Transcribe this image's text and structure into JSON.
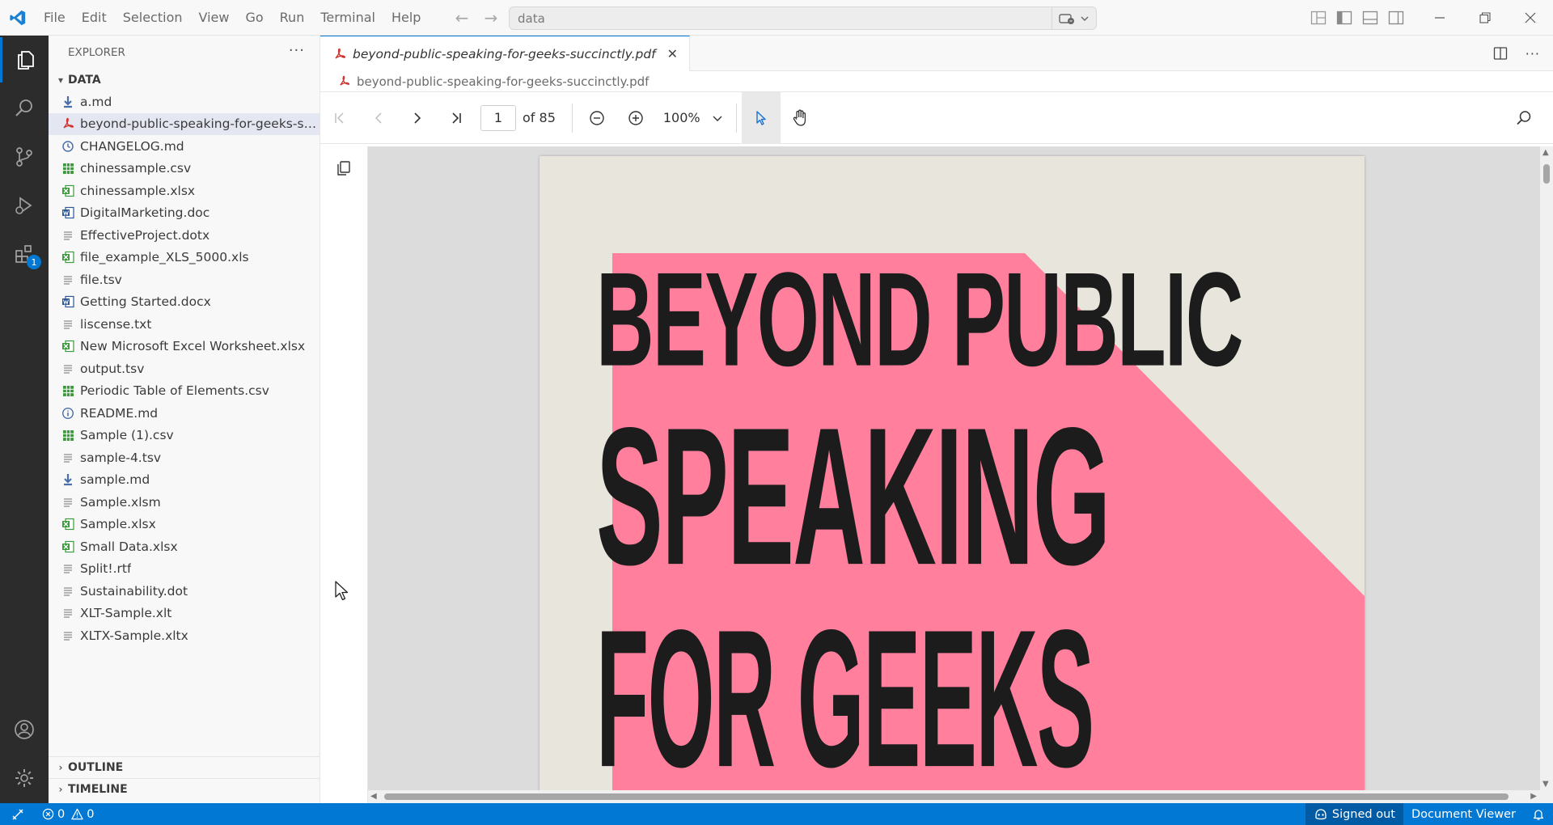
{
  "titlebar": {
    "menus": [
      "File",
      "Edit",
      "Selection",
      "View",
      "Go",
      "Run",
      "Terminal",
      "Help"
    ],
    "search_text": "data"
  },
  "activity": {
    "extensions_badge": "1"
  },
  "sidebar": {
    "title": "EXPLORER",
    "folder": "DATA",
    "files": [
      {
        "name": "a.md",
        "icon": "markdown-icon",
        "color": "#4b6fa8"
      },
      {
        "name": "beyond-public-speaking-for-geeks-succinctly.pdf",
        "icon": "pdf-icon",
        "color": "#d0312d",
        "selected": true
      },
      {
        "name": "CHANGELOG.md",
        "icon": "changelog-icon",
        "color": "#4b6fa8"
      },
      {
        "name": "chinessample.csv",
        "icon": "csv-icon",
        "color": "#3b9a3b"
      },
      {
        "name": "chinessample.xlsx",
        "icon": "excel-icon",
        "color": "#3b9a3b"
      },
      {
        "name": "DigitalMarketing.doc",
        "icon": "word-icon",
        "color": "#2b5797"
      },
      {
        "name": "EffectiveProject.dotx",
        "icon": "text-file-icon",
        "color": "#8a8a8a"
      },
      {
        "name": "file_example_XLS_5000.xls",
        "icon": "excel-icon",
        "color": "#3b9a3b"
      },
      {
        "name": "file.tsv",
        "icon": "text-file-icon",
        "color": "#8a8a8a"
      },
      {
        "name": "Getting Started.docx",
        "icon": "word-icon",
        "color": "#2b5797"
      },
      {
        "name": "liscense.txt",
        "icon": "text-file-icon",
        "color": "#8a8a8a"
      },
      {
        "name": "New Microsoft Excel Worksheet.xlsx",
        "icon": "excel-icon",
        "color": "#3b9a3b"
      },
      {
        "name": "output.tsv",
        "icon": "text-file-icon",
        "color": "#8a8a8a"
      },
      {
        "name": "Periodic Table of Elements.csv",
        "icon": "csv-icon",
        "color": "#3b9a3b"
      },
      {
        "name": "README.md",
        "icon": "info-icon",
        "color": "#4b6fa8"
      },
      {
        "name": "Sample (1).csv",
        "icon": "csv-icon",
        "color": "#3b9a3b"
      },
      {
        "name": "sample-4.tsv",
        "icon": "text-file-icon",
        "color": "#8a8a8a"
      },
      {
        "name": "sample.md",
        "icon": "markdown-icon",
        "color": "#4b6fa8"
      },
      {
        "name": "Sample.xlsm",
        "icon": "text-file-icon",
        "color": "#8a8a8a"
      },
      {
        "name": "Sample.xlsx",
        "icon": "excel-icon",
        "color": "#3b9a3b"
      },
      {
        "name": "Small Data.xlsx",
        "icon": "excel-icon",
        "color": "#3b9a3b"
      },
      {
        "name": "Split!.rtf",
        "icon": "text-file-icon",
        "color": "#8a8a8a"
      },
      {
        "name": "Sustainability.dot",
        "icon": "text-file-icon",
        "color": "#8a8a8a"
      },
      {
        "name": "XLT-Sample.xlt",
        "icon": "text-file-icon",
        "color": "#8a8a8a"
      },
      {
        "name": "XLTX-Sample.xltx",
        "icon": "text-file-icon",
        "color": "#8a8a8a"
      }
    ],
    "outline": "OUTLINE",
    "timeline": "TIMELINE"
  },
  "editor": {
    "tab_label": "beyond-public-speaking-for-geeks-succinctly.pdf",
    "breadcrumb": "beyond-public-speaking-for-geeks-succinctly.pdf"
  },
  "pdf": {
    "current_page": "1",
    "page_count": "of 85",
    "zoom": "100%",
    "cover_lines": [
      "BEYOND PUBLIC",
      "SPEAKING",
      "FOR GEEKS"
    ],
    "cover_background": "#e8e6dc",
    "cover_accent": "#ff7f9c"
  },
  "statusbar": {
    "errors": "0",
    "warnings": "0",
    "account": "Signed out",
    "viewer": "Document Viewer"
  },
  "colors": {
    "accent": "#0078d4",
    "activitybar": "#2c2c2c"
  }
}
